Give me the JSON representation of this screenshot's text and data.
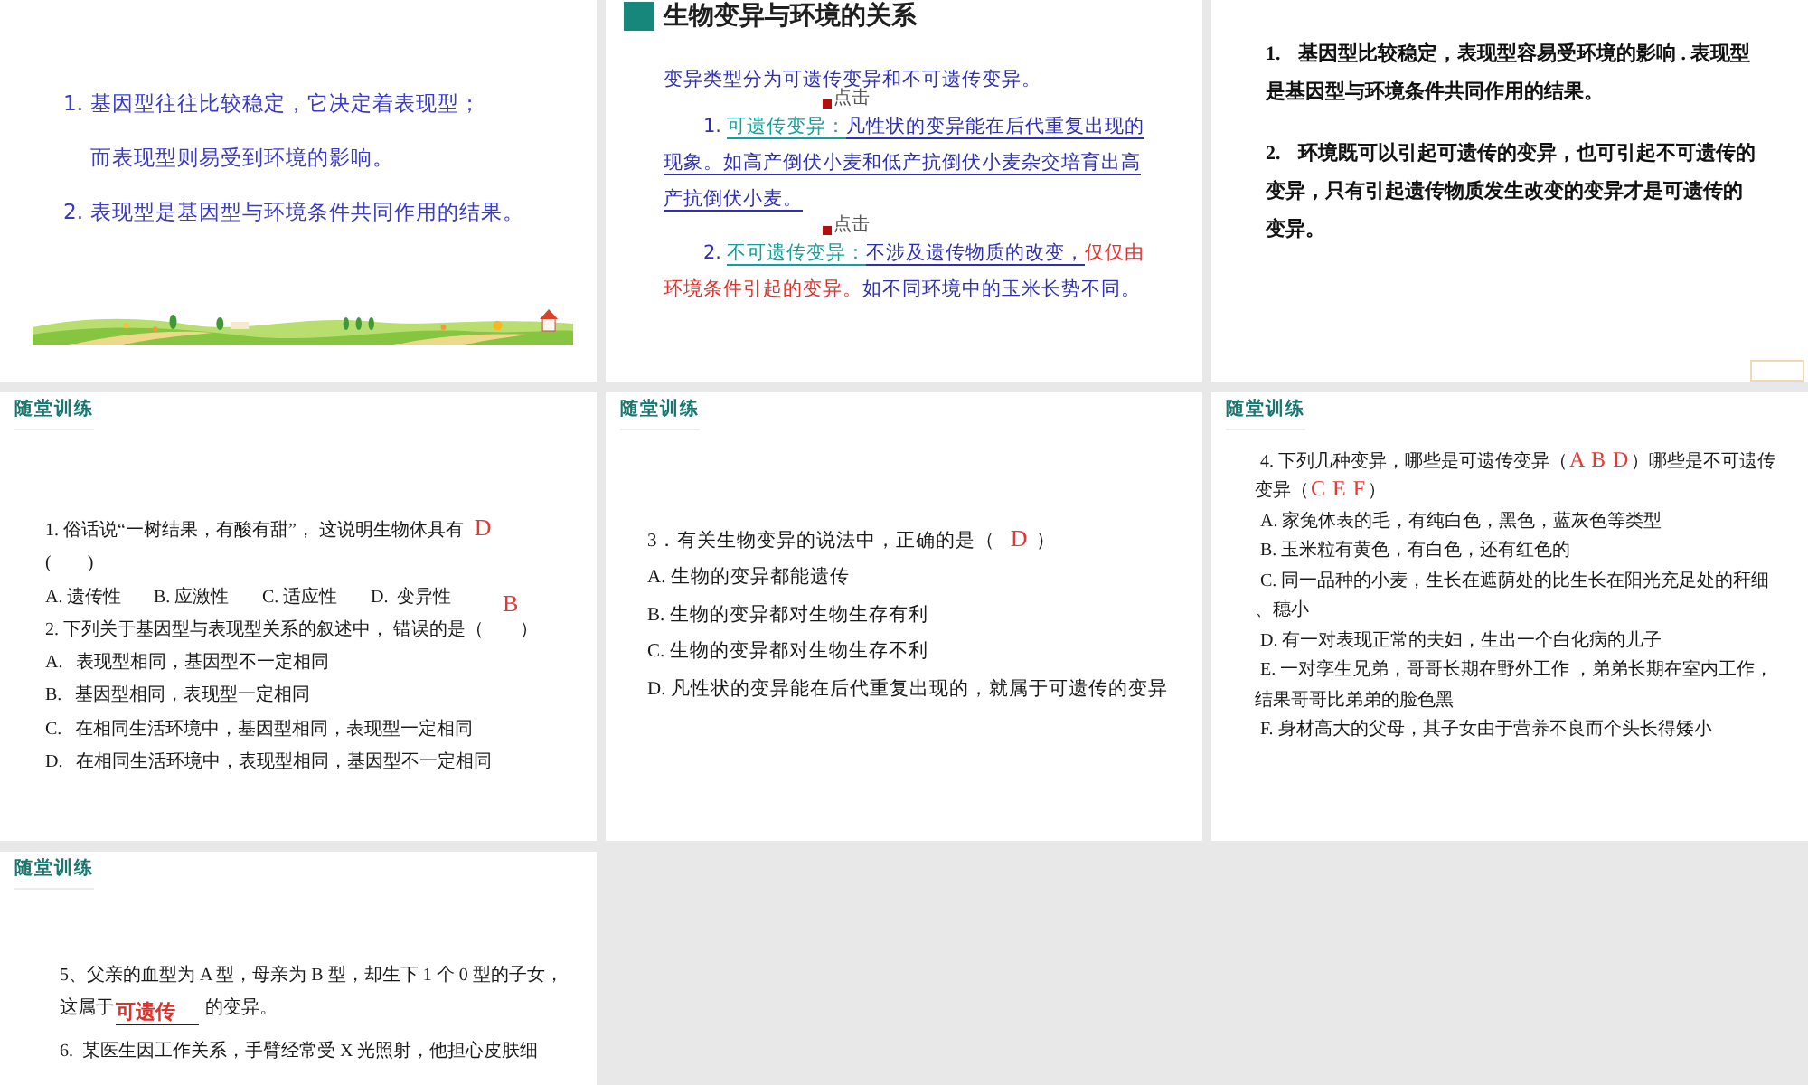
{
  "slides": [
    {
      "kind": "points",
      "points": [
        {
          "number": "1.",
          "lines": [
            "基因型往往比较稳定，它决定着表现型；",
            "而表现型则易受到环境的影响。"
          ]
        },
        {
          "number": "2.",
          "lines": [
            "表现型是基因型与环境条件共同作用的结果。"
          ]
        }
      ]
    },
    {
      "kind": "concept",
      "title": "生物变异与环境的关系",
      "intro": "变异类型分为可遗传变异和不可遗传变异。",
      "items": [
        {
          "link": "点击",
          "number": "1.",
          "lines": [
            [
              {
                "kind": "term",
                "text": "可遗传变异："
              },
              {
                "kind": "underlined",
                "text": "凡性状的变异能在后代重复出现的"
              }
            ],
            [
              {
                "kind": "underlined",
                "text": "现象。如高产倒伏小麦和低产抗倒伏小麦杂交培育出高"
              }
            ],
            [
              {
                "kind": "underlined",
                "text": "产抗倒伏小麦。"
              }
            ]
          ]
        },
        {
          "link": "点击",
          "number": "2.",
          "lines": [
            [
              {
                "kind": "term",
                "text": "不可遗传变异："
              },
              {
                "kind": "underlined",
                "text": "不涉及遗传物质的改变，"
              },
              {
                "kind": "highlight",
                "text": "仅仅由"
              }
            ],
            [
              {
                "kind": "highlight",
                "text": "环境条件引起的变异。"
              },
              {
                "kind": "plain",
                "text": "如不同环境中的玉米长势不同。"
              }
            ]
          ]
        }
      ]
    },
    {
      "kind": "text",
      "paragraphs": [
        {
          "number": "1.",
          "lines": [
            "基因型比较稳定，表现型容易受环境的影响 . 表现型",
            "是基因型与环境条件共同作用的结果。"
          ]
        },
        {
          "number": "2.",
          "lines": [
            "环境既可以引起可遗传的变异，也可引起不可遗传的",
            "变异，只有引起遗传物质发生改变的变异才是可遗传的",
            "变异。"
          ]
        }
      ],
      "corner_box": true
    },
    {
      "kind": "quiz",
      "header": "随堂训练",
      "questions": [
        {
          "kind": "inline",
          "stem": [
            [
              {
                "kind": "plain",
                "text": "1. 俗话说“一树结果，有酸有甜”， 这说明生物体具有"
              },
              {
                "kind": "answer",
                "text": "D"
              }
            ],
            [
              {
                "kind": "plain",
                "text": "(        )"
              }
            ]
          ],
          "options": [
            "A. 遗传性",
            "B. 应激性",
            "C. 适应性",
            "D.  变异性"
          ]
        },
        {
          "kind": "stacked",
          "answer": "B",
          "stem": [
            [
              {
                "kind": "plain",
                "text": "2. 下列关于基因型与表现型关系的叙述中， 错误的是（        ）"
              }
            ]
          ],
          "options": [
            "A.   表现型相同，基因型不一定相同",
            "B.   基因型相同，表现型一定相同",
            "C.   在相同生活环境中，基因型相同，表现型一定相同",
            "D.   在相同生活环境中，表现型相同，基因型不一定相同"
          ]
        }
      ]
    },
    {
      "kind": "quiz",
      "header": "随堂训练",
      "questions": [
        {
          "kind": "stacked",
          "stem": [
            [
              {
                "kind": "plain",
                "text": "3．有关生物变异的说法中，正确的是（ "
              },
              {
                "kind": "answer",
                "text": "D"
              },
              {
                "kind": "plain",
                "text": " ）"
              }
            ]
          ],
          "options": [
            "A. 生物的变异都能遗传",
            "B. 生物的变异都对生物生存有利",
            "C. 生物的变异都对生物生存不利",
            "D. 凡性状的变异能在后代重复出现的，就属于可遗传的变异"
          ]
        }
      ]
    },
    {
      "kind": "quiz",
      "header": "随堂训练",
      "questions": [
        {
          "kind": "stacked",
          "stem": [
            [
              {
                "kind": "plain",
                "text": "4. 下列几种变异，哪些是可遗传变异（"
              },
              {
                "kind": "answer",
                "text": "A B D"
              },
              {
                "kind": "plain",
                "text": "）哪些是不可遗传"
              }
            ],
            [
              {
                "kind": "plain",
                "text": "变异（"
              },
              {
                "kind": "answer",
                "text": "C E F"
              },
              {
                "kind": "plain",
                "text": "）"
              }
            ]
          ],
          "options": [
            "A. 家兔体表的毛，有纯白色，黑色，蓝灰色等类型",
            "B. 玉米粒有黄色，有白色，还有红色的",
            [
              "C. 同一品种的小麦，生长在遮荫处的比生长在阳光充足处的秆细",
              "、穗小"
            ],
            "D. 有一对表现正常的夫妇，生出一个白化病的儿子",
            [
              "E. 一对孪生兄弟，哥哥长期在野外工作 ，弟弟长期在室内工作，",
              "结果哥哥比弟弟的脸色黑"
            ],
            "F. 身材高大的父母，其子女由于营养不良而个头长得矮小"
          ]
        }
      ]
    },
    {
      "kind": "quiz",
      "header": "随堂训练",
      "questions": [
        {
          "kind": "open",
          "stem": [
            [
              {
                "kind": "plain",
                "text": "5、父亲的血型为 A 型，母亲为 B 型，却生下 1 个 0 型的子女，"
              }
            ],
            [
              {
                "kind": "plain",
                "text": "这属于"
              },
              {
                "kind": "blank",
                "text": "可遗传"
              },
              {
                "kind": "plain",
                "text": " 的变异。"
              }
            ]
          ]
        },
        {
          "kind": "open",
          "stem": [
            [
              {
                "kind": "plain",
                "text": "6.  某医生因工作关系，手臂经常受 X 光照射，他担心皮肤细"
              }
            ]
          ]
        }
      ]
    }
  ]
}
